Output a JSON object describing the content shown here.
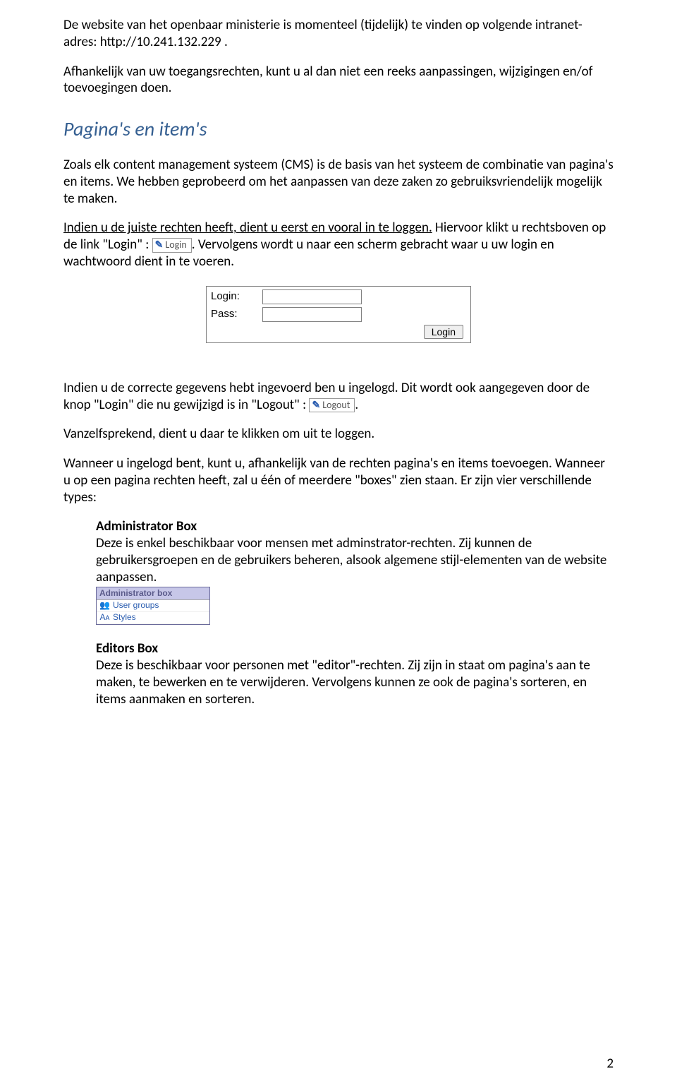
{
  "para1a": "De website van het openbaar ministerie is momenteel (tijdelijk) te vinden op volgende intranet-adres: ",
  "url1": "http://10.241.132.229",
  "para1b": " .",
  "para2": "Afhankelijk van uw toegangsrechten, kunt u al dan niet een reeks aanpassingen, wijzigingen en/of toevoegingen doen.",
  "section_heading": "Pagina's en item's",
  "para3": "Zoals elk content management systeem (CMS) is de basis van het systeem de combinatie van pagina's en items. We hebben geprobeerd om het aanpassen van deze zaken zo gebruiksvriendelijk mogelijk te maken.",
  "para4a": "Indien u de juiste rechten heeft, dient u eerst en vooral in te loggen.",
  "para4b": " Hiervoor klikt u rechtsboven op de link \"Login\" : ",
  "login_btn_label": "Login",
  "para4c": ". Vervolgens wordt u naar een scherm gebracht waar u uw login en wachtwoord dient in te voeren.",
  "form": {
    "login_label": "Login:",
    "pass_label": "Pass:",
    "submit_label": "Login"
  },
  "para5a": "Indien u de correcte gegevens hebt ingevoerd ben u ingelogd. Dit wordt ook aangegeven door de knop \"Login\" die nu gewijzigd is in \"Logout\" : ",
  "logout_btn_label": "Logout",
  "para5b": ".",
  "para6": "Vanzelfsprekend, dient u daar te klikken om uit te loggen.",
  "para7": "Wanneer u ingelogd bent, kunt u, afhankelijk van de rechten pagina's en items toevoegen. Wanneer u op een pagina rechten heeft, zal u één of meerdere \"boxes\" zien staan. Er zijn vier verschillende types:",
  "admin_box": {
    "title": "Administrator Box",
    "desc": "Deze is enkel beschikbaar voor mensen met adminstrator-rechten. Zij kunnen de gebruikersgroepen en de gebruikers beheren, alsook algemene stijl-elementen van de website aanpassen.",
    "box_header": "Administrator box",
    "row1": "User groups",
    "row2": "Styles"
  },
  "editors_box": {
    "title": "Editors Box",
    "desc": "Deze is beschikbaar voor personen met \"editor\"-rechten. Zij zijn in staat om pagina's aan te maken, te bewerken en te verwijderen. Vervolgens kunnen ze ook de pagina's sorteren, en items aanmaken en sorteren."
  },
  "page_number": "2"
}
